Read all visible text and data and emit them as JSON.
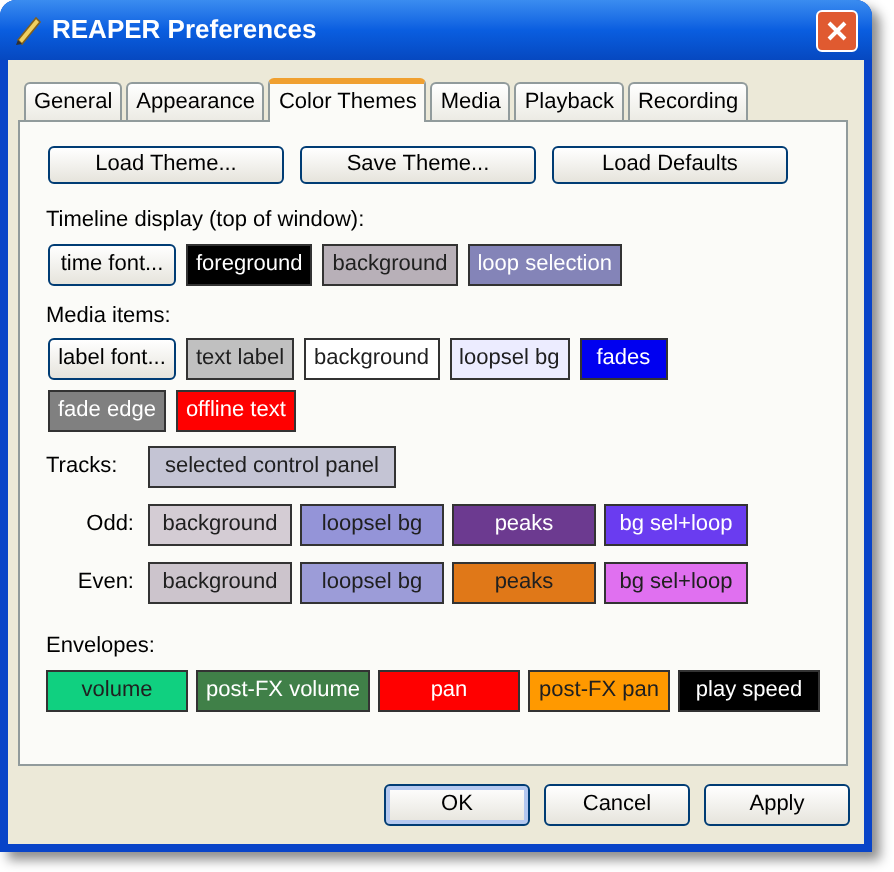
{
  "window": {
    "title": "REAPER Preferences"
  },
  "tabs": [
    {
      "label": "General",
      "selected": false
    },
    {
      "label": "Appearance",
      "selected": false
    },
    {
      "label": "Color Themes",
      "selected": true
    },
    {
      "label": "Media",
      "selected": false
    },
    {
      "label": "Playback",
      "selected": false
    },
    {
      "label": "Recording",
      "selected": false
    }
  ],
  "theme_buttons": [
    "Load Theme...",
    "Save Theme...",
    "Load Defaults"
  ],
  "timeline": {
    "label": "Timeline display (top of window):",
    "rows": [
      [
        {
          "kind": "font",
          "label": "time font..."
        },
        {
          "kind": "swatch",
          "label": "foreground",
          "color": "#000000"
        },
        {
          "kind": "swatch",
          "label": "background",
          "color": "#b8b0b8"
        },
        {
          "kind": "swatch",
          "label": "loop selection",
          "color": "#8484b8"
        }
      ]
    ]
  },
  "media_items": {
    "label": "Media items:",
    "rows": [
      [
        {
          "kind": "font",
          "label": "label font..."
        },
        {
          "kind": "swatch",
          "label": "text label",
          "color": "#c0c0c0"
        },
        {
          "kind": "swatch",
          "label": "background",
          "color": "#ffffff"
        },
        {
          "kind": "swatch",
          "label": "loopsel bg",
          "color": "#ececff"
        },
        {
          "kind": "swatch",
          "label": "fades",
          "color": "#0000f0"
        }
      ],
      [
        {
          "kind": "swatch",
          "label": "fade edge",
          "color": "#808080"
        },
        {
          "kind": "swatch",
          "label": "offline text",
          "color": "#ff0000"
        }
      ]
    ]
  },
  "tracks": {
    "label": "Tracks:",
    "items": [
      {
        "kind": "swatch",
        "label": "selected control panel",
        "color": "#c4c4d4"
      }
    ],
    "rows": [
      {
        "label": "Odd:",
        "items": [
          {
            "kind": "swatch",
            "label": "background",
            "color": "#d4ccd4"
          },
          {
            "kind": "swatch",
            "label": "loopsel bg",
            "color": "#9494d8"
          },
          {
            "kind": "swatch",
            "label": "peaks",
            "color": "#6c3a90"
          },
          {
            "kind": "swatch",
            "label": "bg sel+loop",
            "color": "#6a3cf0"
          }
        ]
      },
      {
        "label": "Even:",
        "items": [
          {
            "kind": "swatch",
            "label": "background",
            "color": "#ccc4cc"
          },
          {
            "kind": "swatch",
            "label": "loopsel bg",
            "color": "#9c9cd8"
          },
          {
            "kind": "swatch",
            "label": "peaks",
            "color": "#e07818"
          },
          {
            "kind": "swatch",
            "label": "bg sel+loop",
            "color": "#e070f0"
          }
        ]
      }
    ]
  },
  "envelopes": {
    "label": "Envelopes:",
    "rows": [
      [
        {
          "kind": "swatch",
          "label": "volume",
          "color": "#10d080"
        },
        {
          "kind": "swatch",
          "label": "post-FX volume",
          "color": "#408048"
        },
        {
          "kind": "swatch",
          "label": "pan",
          "color": "#ff0000"
        },
        {
          "kind": "swatch",
          "label": "post-FX pan",
          "color": "#ff9900"
        },
        {
          "kind": "swatch",
          "label": "play speed",
          "color": "#000000"
        }
      ]
    ]
  },
  "buttons": [
    "OK",
    "Cancel",
    "Apply"
  ]
}
